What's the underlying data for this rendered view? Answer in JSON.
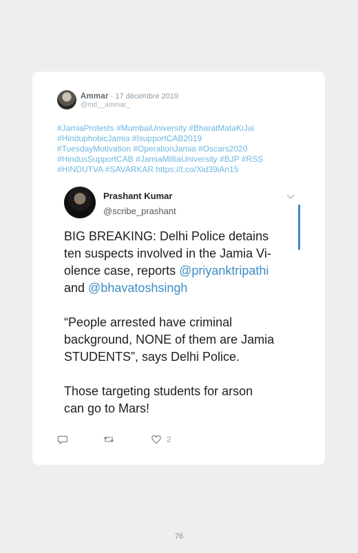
{
  "tweet": {
    "author_name": "Ammar",
    "date": "· 17 décembre 2019",
    "handle": "@md__ammar_",
    "text_lines": [
      "#JamiaProtests #MumbaiUniversity #BharatMataKiJai",
      "#HinduphobicJamia #IsupportCAB2019",
      "#TuesdayMotivation #OperationJamia #Oscars2020",
      "#HindusSupportCAB #JamiaMilliaUniversity #BJP #RSS",
      "#HINDUTVA #SAVARKAR https://t.co/Xid39iAn15"
    ]
  },
  "quoted": {
    "name": "Prashant Kumar",
    "handle": "@scribe_prashant",
    "line1": "BIG BREAKING: Delhi Police detains",
    "line2": "ten suspects involved in the Jamia Vi-",
    "line3_pre": "olence case, reports ",
    "mention1": "@priyanktripathi",
    "line4_pre": "and ",
    "mention2": "@bhavatoshsingh",
    "line5": "“People arrested have criminal",
    "line6": "background, NONE of them are Jamia",
    "line7": "STUDENTS”, says Delhi Police.",
    "line8": "Those targeting students for arson",
    "line9": "can go to Mars!"
  },
  "actions": {
    "like_count": "2"
  },
  "icons": [
    "reply-icon",
    "retweet-icon",
    "like-icon",
    "chevron-down-icon"
  ],
  "colors": {
    "background": "#edeef0",
    "card": "#ffffff",
    "hashtag": "#6cb7e1",
    "mention": "#3e8ec4",
    "scrollbar": "#3d86c9"
  },
  "page_number": "76"
}
